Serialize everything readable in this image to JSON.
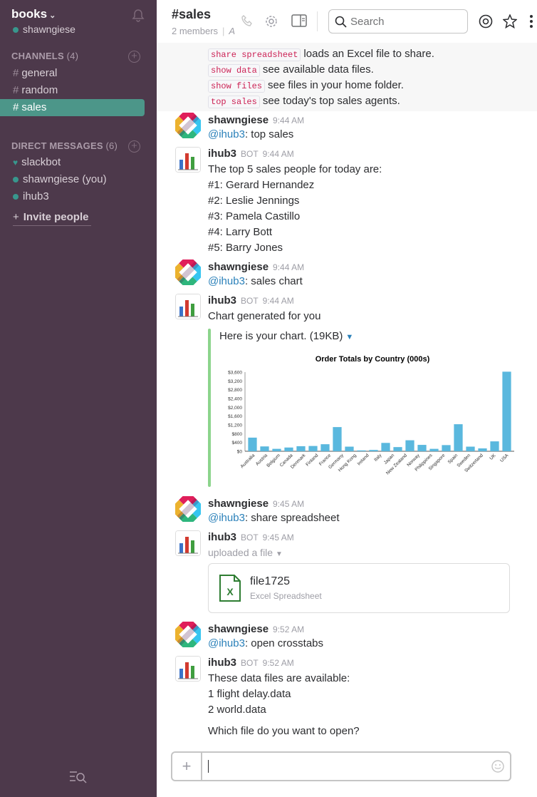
{
  "sidebar": {
    "team_name": "books",
    "user": "shawngiese",
    "channels_header": "CHANNELS",
    "channels_count": "(4)",
    "channels": [
      {
        "label": "general"
      },
      {
        "label": "random"
      },
      {
        "label": "sales",
        "active": true
      }
    ],
    "dm_header": "DIRECT MESSAGES",
    "dm_count": "(6)",
    "direct_messages": [
      {
        "label": "slackbot",
        "icon": "heart-icon"
      },
      {
        "label": "shawngiese (you)",
        "icon": "presence-dot-icon"
      },
      {
        "label": "ihub3",
        "icon": "presence-dot-icon"
      }
    ],
    "invite_label": "Invite people"
  },
  "header": {
    "channel": "#sales",
    "members": "2 members",
    "member_suffix": "A",
    "search_placeholder": "Search"
  },
  "help_lines": [
    {
      "code": "share spreadsheet",
      "text": "loads an Excel file to share."
    },
    {
      "code": "show data",
      "text": "see available data files."
    },
    {
      "code": "show files",
      "text": "see files in your home folder."
    },
    {
      "code": "top sales",
      "text": "see today's top sales agents."
    }
  ],
  "messages": [
    {
      "sender": "shawngiese",
      "time": "9:44 AM",
      "mention": "@ihub3",
      "text": ": top sales"
    },
    {
      "sender": "ihub3",
      "bot": "BOT",
      "time": "9:44 AM",
      "lines": [
        "The top 5 sales people for today are:",
        "#1: Gerard Hernandez",
        "#2: Leslie Jennings",
        "#3: Pamela Castillo",
        "#4: Larry Bott",
        "#5: Barry Jones"
      ]
    },
    {
      "sender": "shawngiese",
      "time": "9:44 AM",
      "mention": "@ihub3",
      "text": ": sales chart"
    },
    {
      "sender": "ihub3",
      "bot": "BOT",
      "time": "9:44 AM",
      "text": "Chart generated for you",
      "caption": "Here is your chart. (19KB)"
    },
    {
      "sender": "shawngiese",
      "time": "9:45 AM",
      "mention": "@ihub3",
      "text": ": share spreadsheet"
    },
    {
      "sender": "ihub3",
      "bot": "BOT",
      "time": "9:45 AM",
      "text": "uploaded a file",
      "file_name": "file1725",
      "file_type": "Excel Spreadsheet"
    },
    {
      "sender": "shawngiese",
      "time": "9:52 AM",
      "mention": "@ihub3",
      "text": ": open crosstabs"
    },
    {
      "sender": "ihub3",
      "bot": "BOT",
      "time": "9:52 AM",
      "lines": [
        "These data files are available:",
        "1 flight delay.data",
        "2 world.data",
        "Which file do you want to open?"
      ]
    }
  ],
  "input": {
    "placeholder": ""
  },
  "chart_data": {
    "type": "bar",
    "title": "Order Totals by Country (000s)",
    "categories": [
      "Australia",
      "Austria",
      "Belgium",
      "Canada",
      "Denmark",
      "Finland",
      "France",
      "Germany",
      "Hong Kong",
      "Ireland",
      "Italy",
      "Japan",
      "New Zealand",
      "Norway",
      "Philippines",
      "Singapore",
      "Spain",
      "Sweden",
      "Switzerland",
      "UK",
      "USA"
    ],
    "values": [
      620,
      220,
      110,
      170,
      230,
      240,
      320,
      1100,
      210,
      40,
      60,
      380,
      190,
      500,
      290,
      110,
      280,
      1230,
      210,
      130,
      450,
      3620
    ],
    "yticks": [
      "$0",
      "$400",
      "$800",
      "$1,200",
      "$1,600",
      "$2,000",
      "$2,400",
      "$2,800",
      "$3,200",
      "$3,600"
    ],
    "ylim": [
      0,
      3600
    ],
    "color": "#5ab8de"
  }
}
